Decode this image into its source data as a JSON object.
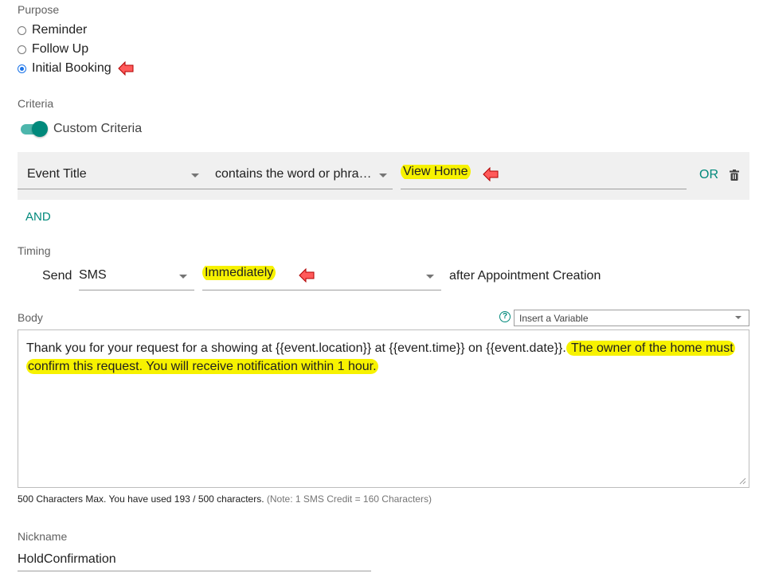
{
  "purpose": {
    "label": "Purpose",
    "options": [
      {
        "label": "Reminder",
        "selected": false
      },
      {
        "label": "Follow Up",
        "selected": false
      },
      {
        "label": "Initial Booking",
        "selected": true
      }
    ]
  },
  "criteria": {
    "label": "Criteria",
    "toggle_label": "Custom Criteria",
    "toggle_on": true,
    "field": "Event Title",
    "operator": "contains the word or phra…",
    "value": "View Home",
    "or_label": "OR",
    "and_label": "AND"
  },
  "timing": {
    "label": "Timing",
    "send_label": "Send",
    "channel": "SMS",
    "when": "Immediately",
    "suffix": "after Appointment Creation"
  },
  "body": {
    "label": "Body",
    "insert_variable_placeholder": "Insert a Variable",
    "text_plain": "Thank you for your request for a showing at {{event.location}} at {{event.time}} on {{event.date}}.",
    "text_highlight_1": " The owner of the home must",
    "text_highlight_2": "confirm this request. You will receive notification within 1 hour.",
    "char_count": "500 Characters Max. You have used 193 / 500 characters.",
    "char_note": "(Note: 1 SMS Credit = 160 Characters)"
  },
  "nickname": {
    "label": "Nickname",
    "value": "HoldConfirmation"
  },
  "colors": {
    "accent": "#00897b",
    "highlight": "#f7f200",
    "annotation_arrow": "#ff5a5a"
  }
}
